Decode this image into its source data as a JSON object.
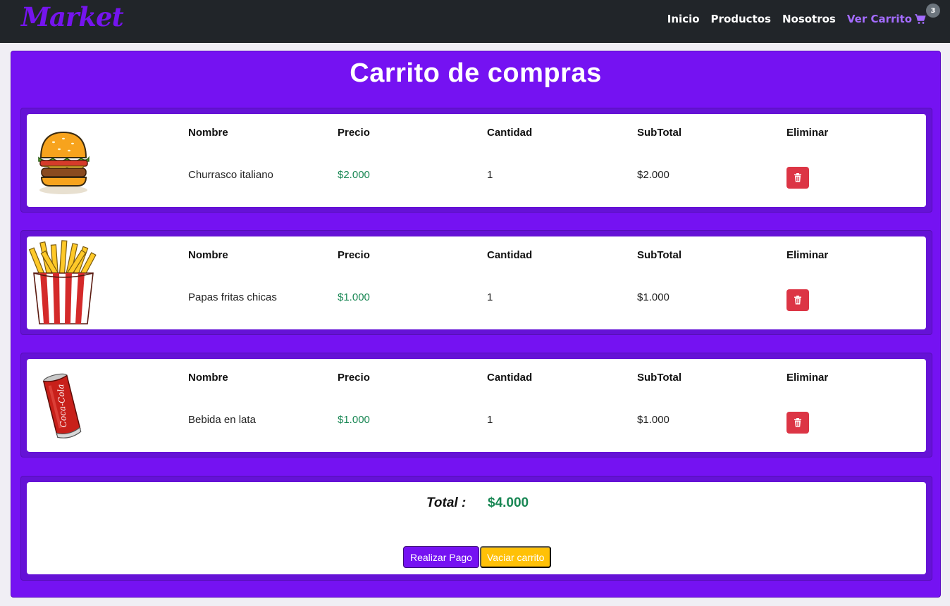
{
  "navbar": {
    "brand": "Market",
    "links": [
      "Inicio",
      "Productos",
      "Nosotros"
    ],
    "cart_label": "Ver Carrito",
    "cart_count": "3"
  },
  "page": {
    "title": "Carrito de compras"
  },
  "columns": {
    "name": "Nombre",
    "price": "Precio",
    "quantity": "Cantidad",
    "subtotal": "SubTotal",
    "remove": "Eliminar"
  },
  "items": [
    {
      "image": "burger-image",
      "name": "Churrasco italiano",
      "price": "$2.000",
      "quantity": "1",
      "subtotal": "$2.000"
    },
    {
      "image": "fries-image",
      "name": "Papas fritas chicas",
      "price": "$1.000",
      "quantity": "1",
      "subtotal": "$1.000"
    },
    {
      "image": "soda-can-image",
      "name": "Bebida en lata",
      "price": "$1.000",
      "quantity": "1",
      "subtotal": "$1.000"
    }
  ],
  "summary": {
    "total_label": "Total :",
    "total_value": "$4.000",
    "pay_button": "Realizar Pago",
    "clear_button": "Vaciar carrito"
  },
  "colors": {
    "primary": "#7512f2",
    "navbar": "#212529",
    "price": "#198754",
    "danger": "#dc3545",
    "warning": "#ffc107"
  }
}
